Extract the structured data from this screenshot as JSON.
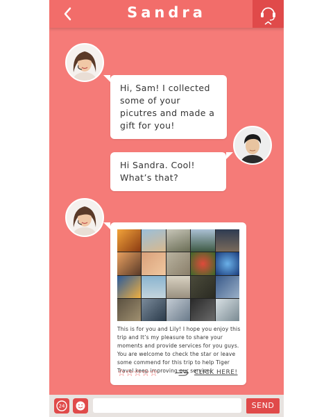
{
  "header": {
    "title": "Sandra",
    "back_icon": "chevron-left-icon",
    "agent_icon": "headset-icon"
  },
  "messages": [
    {
      "sender": "Sandra",
      "side": "left",
      "text": "Hi, Sam!  I collected some of your picutres and made a gift for you!"
    },
    {
      "sender": "Sam",
      "side": "right",
      "text": "Hi Sandra. Cool! What’s that?"
    },
    {
      "sender": "Sandra",
      "side": "left",
      "type": "gift",
      "text": "This is for you and Lily! I hope you enjoy this trip and It’s my pleasure to share your moments and provide services for you guys. You are welcome to check the star or leave some commend for this trip to help Tiger Travel keep improving our service!",
      "rating_max": 5,
      "rating_glyph": "☆☆☆☆☆",
      "link_label": "CLICK HERE!"
    }
  ],
  "footer": {
    "send_label": "SEND",
    "input_value": "",
    "left_icons": [
      "24h-service-icon",
      "emoji-icon"
    ]
  },
  "colors": {
    "background": "#f57b78",
    "header": "#f26d6a",
    "accent": "#e04a4a",
    "bubble": "#ffffff"
  }
}
